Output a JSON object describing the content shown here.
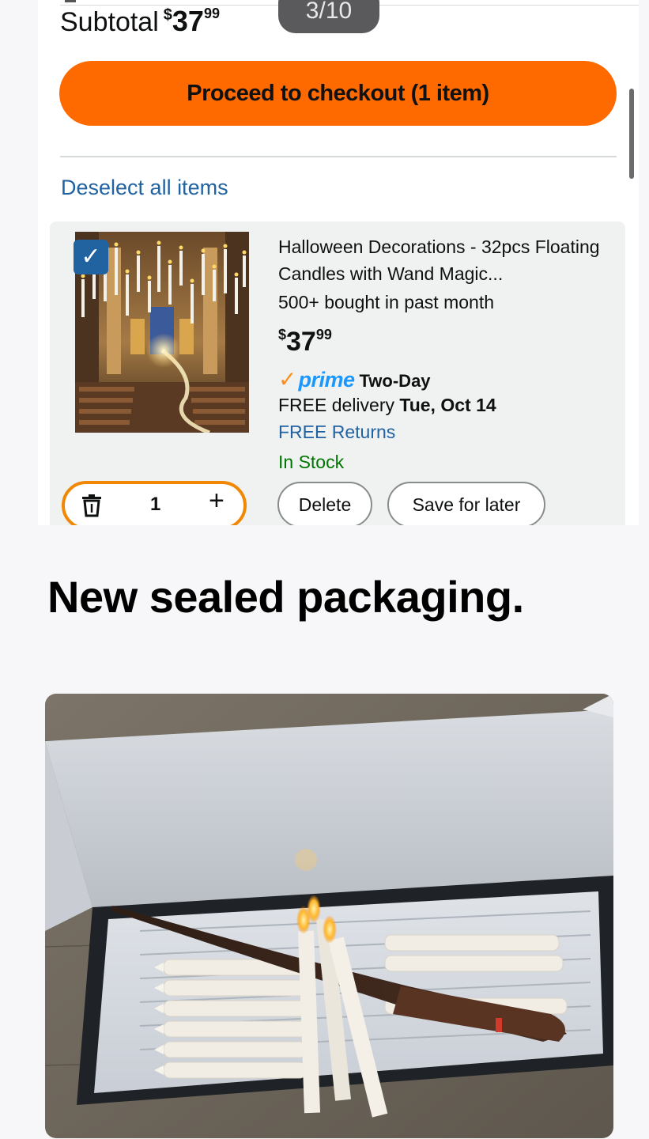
{
  "cart": {
    "subtotal_label": "Subtotal",
    "subtotal_currency": "$",
    "subtotal_whole": "37",
    "subtotal_cents": "99",
    "checkout_label": "Proceed to checkout (1 item)",
    "deselect_label": "Deselect all items"
  },
  "pager": {
    "text": "3/10"
  },
  "item": {
    "title": "Halloween Decorations - 32pcs Floating Candles with Wand Magic...",
    "bought": "500+ bought in past month",
    "price_currency": "$",
    "price_whole": "37",
    "price_cents": "99",
    "prime_word": "prime",
    "prime_speed": "Two-Day",
    "delivery_prefix": "FREE delivery",
    "delivery_date": "Tue, Oct 14",
    "returns": "FREE Returns",
    "stock": "In Stock",
    "quantity": "1",
    "plus_label": "+",
    "delete_label": "Delete",
    "save_label": "Save for later",
    "checkbox_mark": "✓"
  },
  "caption": {
    "text": "New sealed packaging."
  },
  "colors": {
    "checkout_button": "#ff6a00",
    "link_blue": "#2162a1",
    "in_stock_green": "#007600",
    "prime_blue": "#1a98ff",
    "quantity_border": "#f08804"
  },
  "icons": {
    "checkbox": "checkbox-checked-icon",
    "trash": "trash-icon",
    "plus": "plus-icon",
    "prime_check": "prime-check-icon"
  }
}
